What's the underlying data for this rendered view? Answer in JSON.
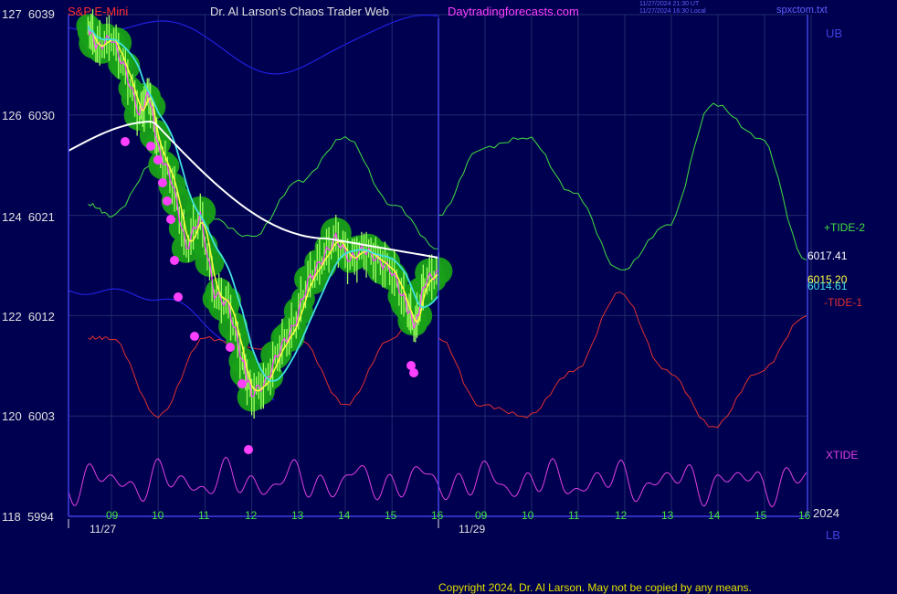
{
  "header": {
    "instrument": "S&P E-Mini",
    "author": "Dr. Al Larson's Chaos Trader Web",
    "site": "Daytradingforecasts.com",
    "timestamp_line1": "11/27/2024 21:30 UT",
    "timestamp_line2": "11/27/2024 16:30 Local",
    "filename": "spxctom.txt"
  },
  "y_axis": {
    "labels": [
      {
        "pair": "127  6039"
      },
      {
        "pair": "126  6030"
      },
      {
        "pair": "124  6021"
      },
      {
        "pair": "122  6012"
      },
      {
        "pair": "120  6003"
      },
      {
        "pair": "118  5994"
      }
    ]
  },
  "x_axis": {
    "hours_day1": [
      "09",
      "10",
      "11",
      "12",
      "13",
      "14",
      "15",
      "16"
    ],
    "hours_day2": [
      "09",
      "10",
      "11",
      "12",
      "13",
      "14",
      "15",
      "16"
    ],
    "dates": [
      "11/27",
      "11/29"
    ],
    "year": "2024"
  },
  "right_labels": {
    "ub": "UB",
    "tide2": "+TIDE-2",
    "price_white": "6017.41",
    "price_yellow": "6015.20",
    "price_cyan": "6014.61",
    "tide1": "-TIDE-1",
    "xtide": "XTIDE",
    "lb": "LB"
  },
  "colors": {
    "background": "#000050",
    "grid": "#1e2c6a",
    "axis": "#4040e0",
    "price_bar": "#ff40ff",
    "yellow_ma": "#ffff40",
    "cyan_ma": "#40e0e0",
    "white_ma": "#ffffff",
    "bubble": "#18a018",
    "tide2": "#40e040",
    "tide1": "#e03030",
    "xtide": "#e040e0",
    "band": "#2020e0"
  },
  "footer": {
    "copyright": "Copyright 2024, Dr. Al Larson. May not be copied by any means."
  },
  "chart_data": {
    "type": "line",
    "title": "S&P E-Mini",
    "y_range": [
      5994,
      6039
    ],
    "y_ticks": [
      6039,
      6030,
      6021,
      6012,
      6003,
      5994
    ],
    "x_range_hours": [
      8.5,
      24.1
    ],
    "series": [
      {
        "name": "S&P E-Mini",
        "x": [
          8.5,
          8.7,
          9.0,
          9.3,
          9.6,
          9.8,
          10.0,
          10.3,
          10.6,
          10.9,
          11.2,
          11.5,
          11.8,
          12.0,
          12.3,
          12.6,
          12.9,
          13.2,
          13.5,
          13.8,
          14.1,
          14.4,
          14.7,
          15.0,
          15.3,
          15.5,
          15.7,
          16.0
        ],
        "values": [
          6038,
          6036,
          6037,
          6034,
          6030,
          6032,
          6027,
          6024,
          6018,
          6021,
          6014,
          6013,
          6008,
          6005,
          6006,
          6009,
          6011,
          6015,
          6017,
          6019,
          6017,
          6018,
          6017,
          6016,
          6013,
          6011,
          6015,
          6016
        ]
      },
      {
        "name": "+TIDE-2",
        "x": [
          8.5,
          9.0,
          10.0,
          11.0,
          12.0,
          13.0,
          14.0,
          15.0,
          16.0,
          16.1,
          17.0,
          18.0,
          19.0,
          20.0,
          21.0,
          22.0,
          23.0,
          24.0
        ],
        "values": [
          6022,
          6021,
          6026,
          6021,
          6019,
          6024,
          6028,
          6022,
          6018,
          6021,
          6027,
          6028,
          6023,
          6016,
          6020,
          6031,
          6028,
          6017
        ]
      },
      {
        "name": "-TIDE-1",
        "x": [
          8.5,
          9.0,
          10.0,
          11.0,
          12.0,
          13.0,
          14.0,
          15.0,
          16.0,
          16.1,
          17.0,
          18.0,
          19.0,
          20.0,
          21.0,
          22.0,
          23.0,
          24.0
        ],
        "values": [
          6010,
          6010,
          6003,
          6010,
          6009,
          6010,
          6004,
          6010,
          6016,
          6010,
          6004,
          6003,
          6007,
          6014,
          6007,
          6002,
          6007,
          6012
        ]
      }
    ],
    "legend": "right"
  }
}
